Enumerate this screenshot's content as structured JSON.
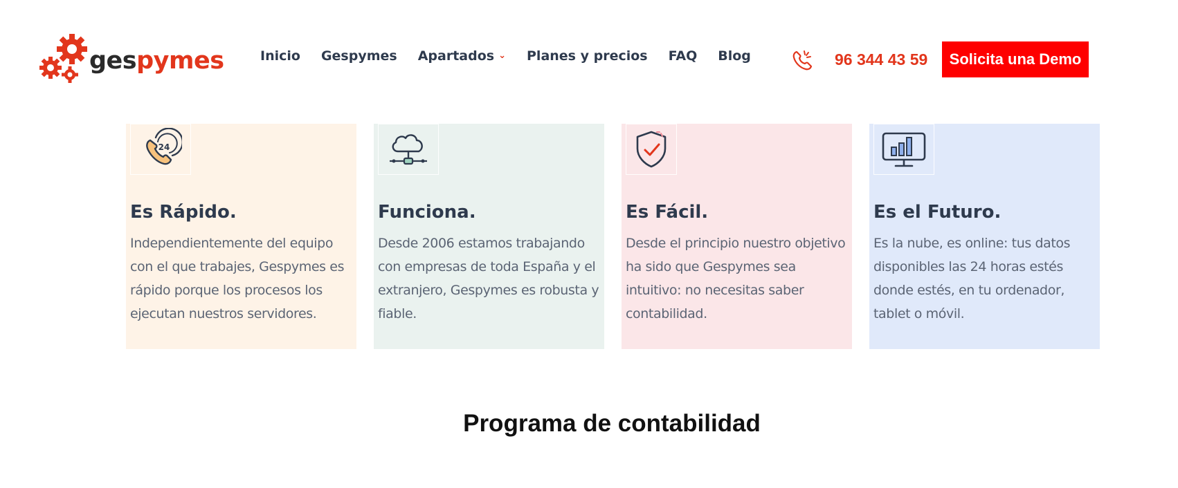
{
  "brand": {
    "name_part1": "ges",
    "name_part2": "pymes",
    "color": "#e2361c"
  },
  "nav": {
    "items": [
      {
        "label": "Inicio"
      },
      {
        "label": "Gespymes"
      },
      {
        "label": "Apartados",
        "has_dropdown": true
      },
      {
        "label": "Planes y precios"
      },
      {
        "label": "FAQ"
      },
      {
        "label": "Blog"
      }
    ]
  },
  "contact": {
    "phone": "96 344 43 59",
    "icon": "phone-icon"
  },
  "cta": {
    "label": "Solicita una Demo",
    "color": "#fe0000"
  },
  "features": [
    {
      "icon": "phone-24h-icon",
      "title": "Es Rápido.",
      "text": "Independientemente del equipo con el que trabajes, Gespymes es rápido porque los procesos los ejecutan nuestros servidores.",
      "bg": "#fef3e7"
    },
    {
      "icon": "cloud-network-icon",
      "title": "Funciona.",
      "text": "Desde 2006 estamos trabajando con empresas de toda España y el extranjero, Gespymes es robusta y fiable.",
      "bg": "#eaf2ef"
    },
    {
      "icon": "shield-check-icon",
      "title": "Es Fácil.",
      "text": "Desde el principio nuestro objetivo ha sido que Gespymes sea intuitivo: no necesitas saber contabilidad.",
      "bg": "#fbe6e8"
    },
    {
      "icon": "monitor-chart-icon",
      "title": "Es el Futuro.",
      "text": "Es la nube, es online: tus datos disponibles las 24 horas estés donde estés, en tu ordenador, tablet o móvil.",
      "bg": "#e0e9fa"
    }
  ],
  "section": {
    "title": "Programa de contabilidad"
  }
}
